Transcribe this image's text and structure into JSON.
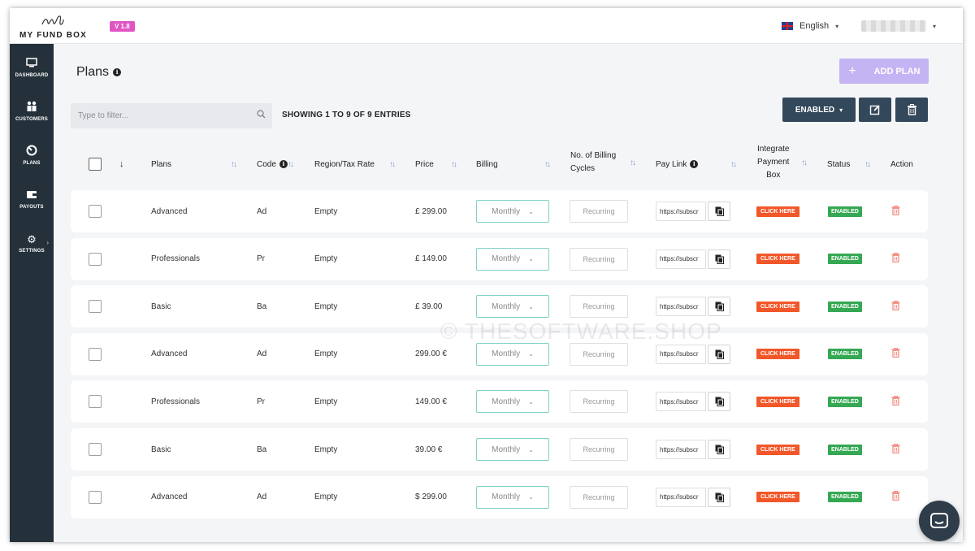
{
  "header": {
    "logo_text": "MY FUND BOX",
    "version": "V 1.8",
    "language": "English"
  },
  "sidebar": {
    "items": [
      {
        "label": "DASHBOARD",
        "icon": "monitor-icon"
      },
      {
        "label": "CUSTOMERS",
        "icon": "users-icon"
      },
      {
        "label": "PLANS",
        "icon": "plans-icon"
      },
      {
        "label": "PAYOUTS",
        "icon": "wallet-icon"
      },
      {
        "label": "SETTINGS",
        "icon": "gear-icon"
      }
    ]
  },
  "main": {
    "title": "Plans",
    "add_button": "ADD PLAN",
    "filter_placeholder": "Type to filter...",
    "showing_text": "SHOWING 1 TO 9 OF 9 ENTRIES",
    "status_filter": "ENABLED"
  },
  "table": {
    "columns": {
      "plans": "Plans",
      "code": "Code",
      "region": "Region/Tax Rate",
      "price": "Price",
      "billing": "Billing",
      "cycles_line1": "No. of Billing",
      "cycles_line2": "Cycles",
      "pay_link": "Pay Link",
      "ipb_line1": "Integrate",
      "ipb_line2": "Payment",
      "ipb_line3": "Box",
      "status": "Status",
      "action": "Action"
    },
    "rows": [
      {
        "plan": "Advanced",
        "code": "Ad",
        "region": "Empty",
        "price": "£ 299.00",
        "billing": "Monthly",
        "cycles": "Recurring",
        "pay_link": "https://subscr",
        "integrate": "CLICK HERE",
        "status": "ENABLED"
      },
      {
        "plan": "Professionals",
        "code": "Pr",
        "region": "Empty",
        "price": "£ 149.00",
        "billing": "Monthly",
        "cycles": "Recurring",
        "pay_link": "https://subscr",
        "integrate": "CLICK HERE",
        "status": "ENABLED"
      },
      {
        "plan": "Basic",
        "code": "Ba",
        "region": "Empty",
        "price": "£ 39.00",
        "billing": "Monthly",
        "cycles": "Recurring",
        "pay_link": "https://subscr",
        "integrate": "CLICK HERE",
        "status": "ENABLED"
      },
      {
        "plan": "Advanced",
        "code": "Ad",
        "region": "Empty",
        "price": "299.00 €",
        "billing": "Monthly",
        "cycles": "Recurring",
        "pay_link": "https://subscr",
        "integrate": "CLICK HERE",
        "status": "ENABLED"
      },
      {
        "plan": "Professionals",
        "code": "Pr",
        "region": "Empty",
        "price": "149.00 €",
        "billing": "Monthly",
        "cycles": "Recurring",
        "pay_link": "https://subscr",
        "integrate": "CLICK HERE",
        "status": "ENABLED"
      },
      {
        "plan": "Basic",
        "code": "Ba",
        "region": "Empty",
        "price": "39.00 €",
        "billing": "Monthly",
        "cycles": "Recurring",
        "pay_link": "https://subscr",
        "integrate": "CLICK HERE",
        "status": "ENABLED"
      },
      {
        "plan": "Advanced",
        "code": "Ad",
        "region": "Empty",
        "price": "$ 299.00",
        "billing": "Monthly",
        "cycles": "Recurring",
        "pay_link": "https://subscr",
        "integrate": "CLICK HERE",
        "status": "ENABLED"
      }
    ]
  },
  "watermark": "© THESOFTWARE.SHOP",
  "colors": {
    "sidebar": "#24313b",
    "primary_dark": "#33485b",
    "add_button": "#c4b4f3",
    "version_badge": "#e055c4",
    "click_here": "#f2572a",
    "enabled_badge": "#35a853",
    "billing_border": "#7fd1c6"
  }
}
